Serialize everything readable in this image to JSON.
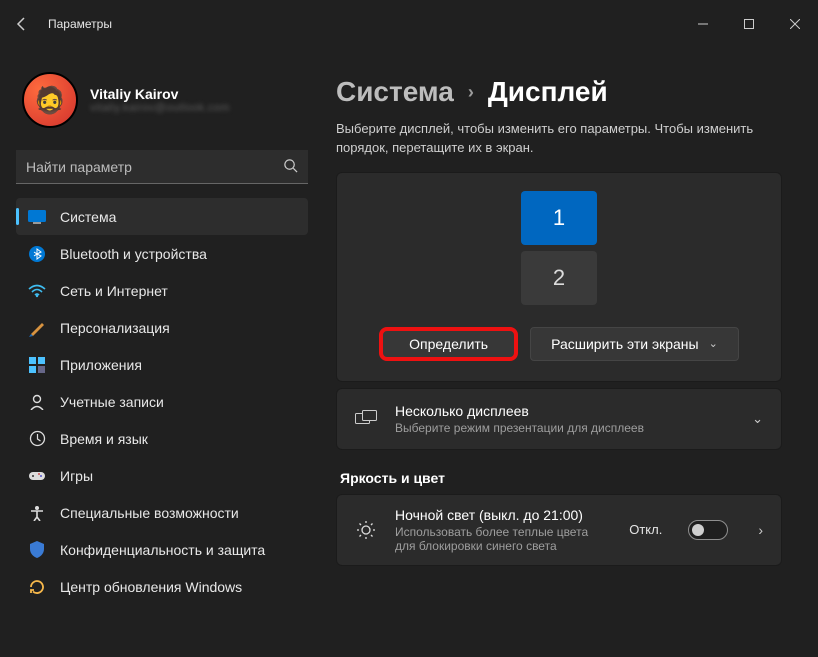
{
  "window": {
    "title": "Параметры"
  },
  "profile": {
    "name": "Vitaliy Kairov",
    "email": "vitaliy.kairov@outlook.com"
  },
  "search": {
    "placeholder": "Найти параметр"
  },
  "nav": {
    "items": [
      {
        "label": "Система",
        "icon": "system"
      },
      {
        "label": "Bluetooth и устройства",
        "icon": "bluetooth"
      },
      {
        "label": "Сеть и Интернет",
        "icon": "wifi"
      },
      {
        "label": "Персонализация",
        "icon": "personalization"
      },
      {
        "label": "Приложения",
        "icon": "apps"
      },
      {
        "label": "Учетные записи",
        "icon": "accounts"
      },
      {
        "label": "Время и язык",
        "icon": "time"
      },
      {
        "label": "Игры",
        "icon": "gaming"
      },
      {
        "label": "Специальные возможности",
        "icon": "accessibility"
      },
      {
        "label": "Конфиденциальность и защита",
        "icon": "privacy"
      },
      {
        "label": "Центр обновления Windows",
        "icon": "update"
      }
    ],
    "selected_index": 0
  },
  "breadcrumb": {
    "parent": "Система",
    "current": "Дисплей"
  },
  "display": {
    "hint": "Выберите дисплей, чтобы изменить его параметры. Чтобы изменить порядок, перетащите их в экран.",
    "monitors": [
      {
        "id": "1",
        "selected": true
      },
      {
        "id": "2",
        "selected": false
      }
    ],
    "identify_label": "Определить",
    "extend_label": "Расширить эти экраны"
  },
  "multi_display": {
    "title": "Несколько дисплеев",
    "subtitle": "Выберите режим презентации для дисплеев"
  },
  "brightness_section": {
    "header": "Яркость и цвет",
    "night_light": {
      "title": "Ночной свет (выкл. до 21:00)",
      "subtitle": "Использовать более теплые цвета для блокировки синего света",
      "state": "Откл.",
      "on": false
    }
  }
}
